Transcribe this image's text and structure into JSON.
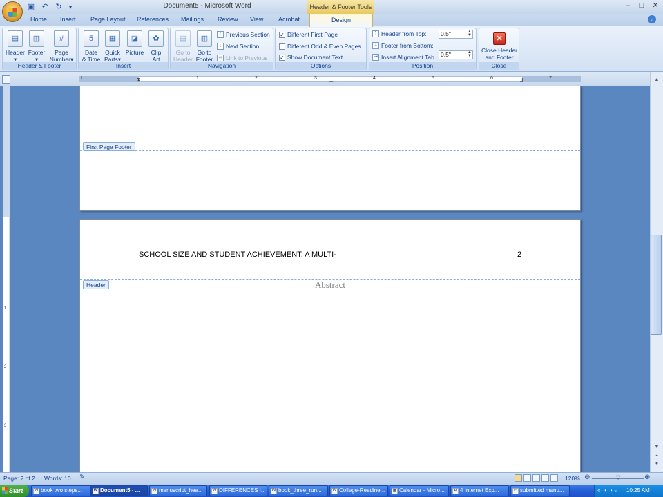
{
  "window": {
    "title": "Document5 - Microsoft Word",
    "contextual_label": "Header & Footer Tools"
  },
  "tabs": [
    "Home",
    "Insert",
    "Page Layout",
    "References",
    "Mailings",
    "Review",
    "View",
    "Acrobat"
  ],
  "active_tab": "Design",
  "ribbon": {
    "groups": {
      "header_footer": "Header & Footer",
      "insert": "Insert",
      "navigation": "Navigation",
      "options": "Options",
      "position": "Position",
      "close": "Close"
    },
    "header_btn": "Header",
    "footer_btn": "Footer",
    "page_number_1": "Page",
    "page_number_2": "Number",
    "date_time_1": "Date",
    "date_time_2": "& Time",
    "quick_parts_1": "Quick",
    "quick_parts_2": "Parts",
    "picture": "Picture",
    "clip_art_1": "Clip",
    "clip_art_2": "Art",
    "go_header_1": "Go to",
    "go_header_2": "Header",
    "go_footer_1": "Go to",
    "go_footer_2": "Footer",
    "prev_section": "Previous Section",
    "next_section": "Next Section",
    "link_previous": "Link to Previous",
    "diff_first": "Different First Page",
    "diff_odd_even": "Different Odd & Even Pages",
    "show_doc_text": "Show Document Text",
    "header_from_top": "Header from Top:",
    "header_from_top_value": "0.5\"",
    "footer_from_bottom": "Footer from Bottom:",
    "footer_from_bottom_value": "0.5\"",
    "insert_alignment_tab": "Insert Alignment Tab",
    "close_1": "Close Header",
    "close_2": "and Footer"
  },
  "checkboxes": {
    "diff_first": true,
    "diff_odd_even": false,
    "show_doc_text": true
  },
  "ruler_numbers": [
    "1",
    "1",
    "2",
    "3",
    "4",
    "5",
    "6",
    "7"
  ],
  "vruler_numbers": [
    "1",
    "2",
    "3"
  ],
  "document": {
    "first_page_footer_tag": "First Page Footer",
    "header_tag": "Header",
    "header_text": "SCHOOL SIZE AND STUDENT ACHIEVEMENT: A MULTI-",
    "page_number": "2",
    "abstract": "Abstract"
  },
  "status": {
    "page": "Page: 2 of 2",
    "words": "Words: 10",
    "zoom": "120%"
  },
  "taskbar": {
    "start": "Start",
    "items": [
      "book two steps...",
      "Document5 - ...",
      "manuscript_hea...",
      "DIFFERENCES I...",
      "book_three_run...",
      "College-Readine...",
      "Calendar - Micro...",
      "4 Internet Exp...",
      "submitted manu..."
    ],
    "clock": "10:25 AM"
  }
}
